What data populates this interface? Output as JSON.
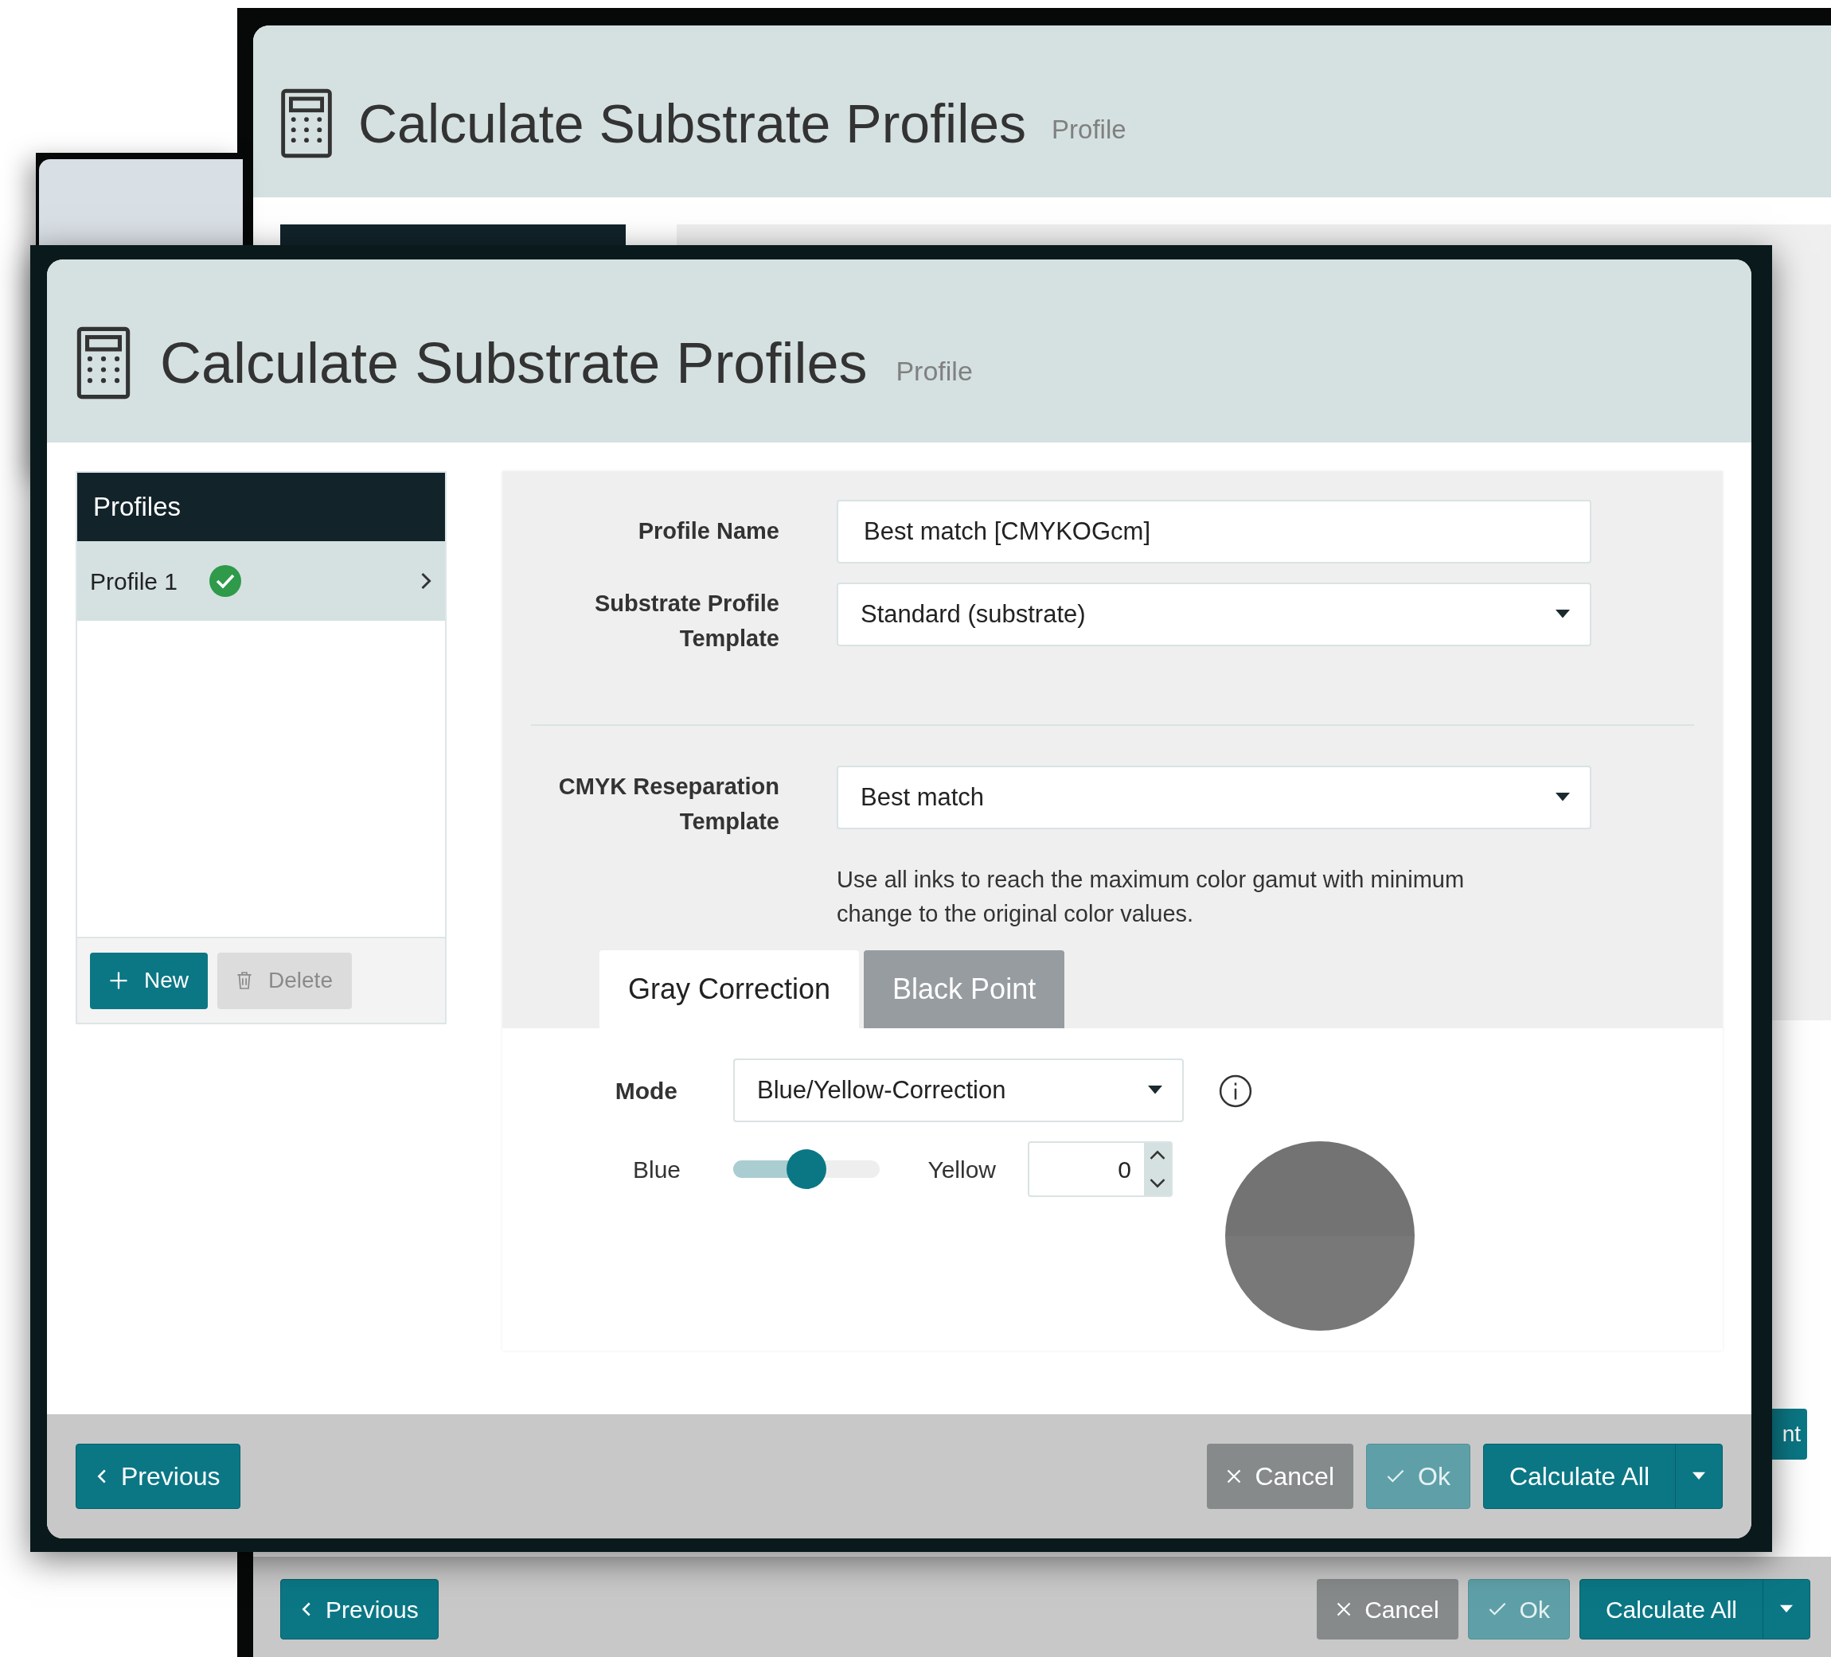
{
  "background_window": {
    "title": "Calculate Substrate Profiles",
    "subtitle": "Profile",
    "side_button": "nt",
    "footer_buttons": [
      {
        "kind": "previous",
        "label": "Previous"
      },
      {
        "kind": "cancel",
        "label": "Cancel"
      },
      {
        "kind": "ok",
        "label": "Ok"
      },
      {
        "kind": "split",
        "label": "Calculate All"
      }
    ]
  },
  "dialog": {
    "title": "Calculate Substrate Profiles",
    "subtitle": "Profile",
    "sidebar": {
      "heading": "Profiles",
      "items": [
        {
          "label": "Profile 1",
          "selected": true,
          "valid": true
        }
      ],
      "buttons": [
        {
          "kind": "new",
          "label": "New",
          "disabled": false
        },
        {
          "kind": "delete",
          "label": "Delete",
          "disabled": true
        }
      ]
    },
    "form": {
      "profile_name": {
        "label": "Profile Name",
        "value": "Best match [CMYKOGcm]"
      },
      "substrate_template": {
        "label": "Substrate Profile Template",
        "value": "Standard (substrate)"
      },
      "cmyk_template": {
        "label": "CMYK Reseparation Template",
        "value": "Best match"
      },
      "description": "Use all inks to reach the maximum color gamut with minimum change to the original color values."
    },
    "tabs": [
      {
        "label": "Gray Correction",
        "selected": true
      },
      {
        "label": "Black Point",
        "selected": false
      }
    ],
    "gray_correction": {
      "mode_label": "Mode",
      "mode_value": "Blue/Yellow-Correction",
      "left_label": "Blue",
      "right_label": "Yellow",
      "level": 0.5,
      "value": "0"
    },
    "footer_buttons": [
      {
        "kind": "previous",
        "label": "Previous"
      },
      {
        "kind": "cancel",
        "label": "Cancel"
      },
      {
        "kind": "ok",
        "label": "Ok"
      },
      {
        "kind": "split",
        "label": "Calculate All"
      }
    ]
  }
}
